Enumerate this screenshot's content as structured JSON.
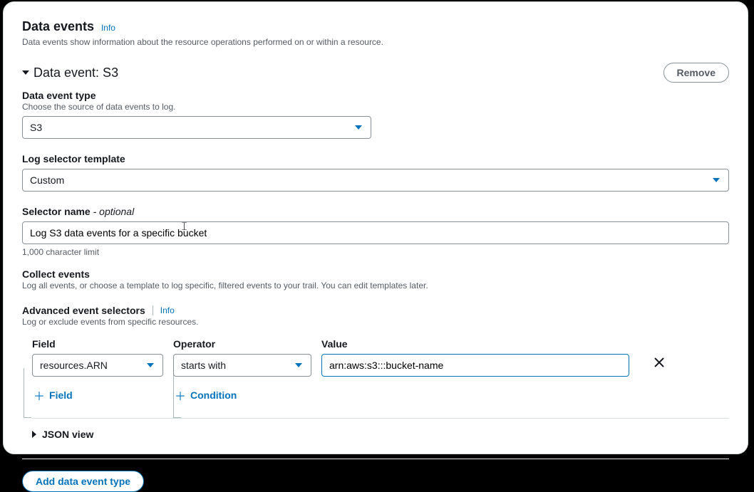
{
  "header": {
    "title": "Data events",
    "info": "Info",
    "desc": "Data events show information about the resource operations performed on or within a resource."
  },
  "event": {
    "title": "Data event: S3",
    "remove": "Remove"
  },
  "type": {
    "label": "Data event type",
    "help": "Choose the source of data events to log.",
    "value": "S3"
  },
  "template": {
    "label": "Log selector template",
    "value": "Custom"
  },
  "selectorName": {
    "label": "Selector name",
    "optional": " - optional",
    "value": "Log S3 data events for a specific bucket",
    "limit": "1,000 character limit"
  },
  "collect": {
    "label": "Collect events",
    "help": "Log all events, or choose a template to log specific, filtered events to your trail. You can edit templates later."
  },
  "advanced": {
    "label": "Advanced event selectors",
    "info": "Info",
    "help": "Log or exclude events from specific resources."
  },
  "cols": {
    "field": "Field",
    "operator": "Operator",
    "value": "Value"
  },
  "row": {
    "field": "resources.ARN",
    "operator": "starts with",
    "value": "arn:aws:s3:::bucket-name"
  },
  "add": {
    "field": "Field",
    "condition": "Condition"
  },
  "json": {
    "title": "JSON view"
  },
  "footer": {
    "addType": "Add data event type"
  }
}
